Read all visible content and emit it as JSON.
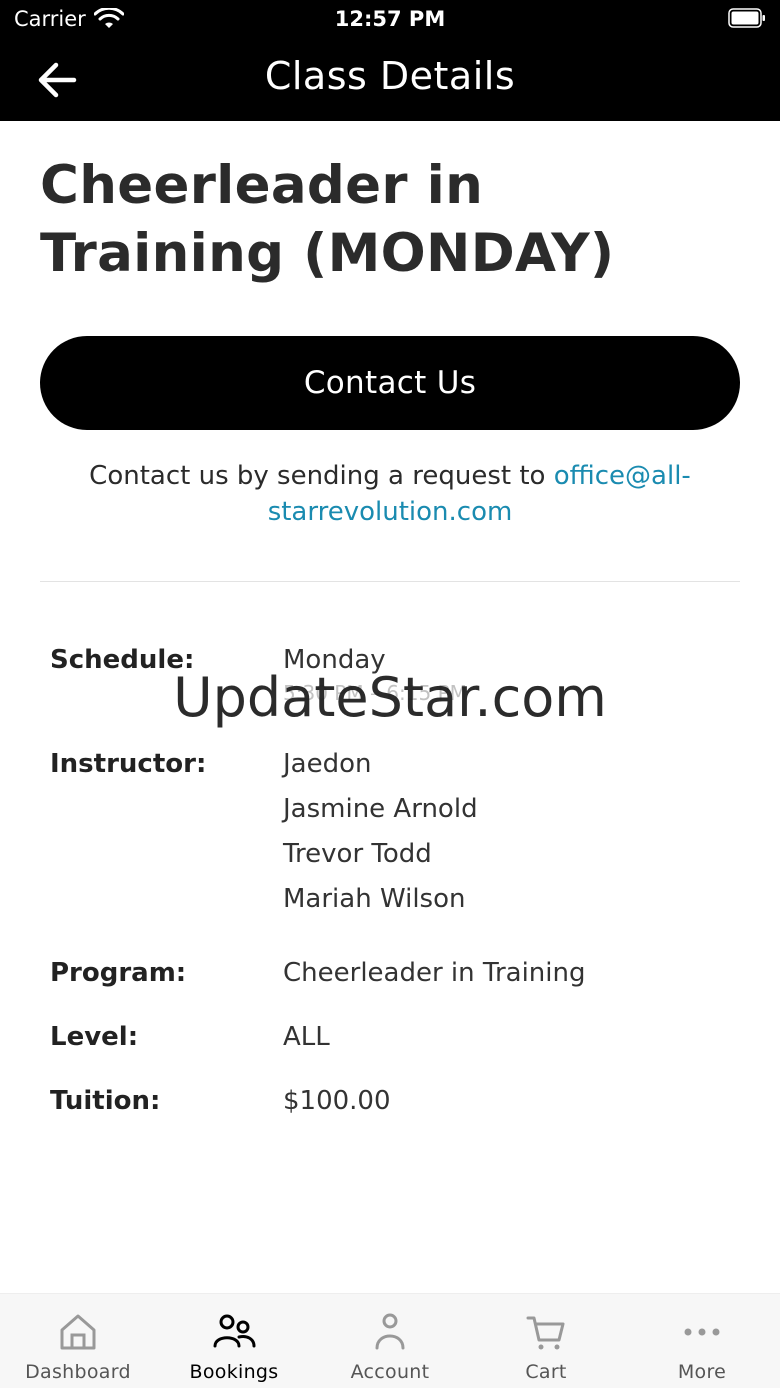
{
  "status_bar": {
    "carrier": "Carrier",
    "time": "12:57 PM"
  },
  "nav": {
    "title": "Class Details"
  },
  "class": {
    "title": "Cheerleader in Training (MONDAY)"
  },
  "contact": {
    "button_label": "Contact Us",
    "note_prefix": "Contact us by sending a request to ",
    "email": "office@all-starrevolution.com"
  },
  "details": {
    "schedule_label": "Schedule:",
    "schedule_day": "Monday",
    "schedule_time": "5:30 PM – 6:15 PM",
    "instructor_label": "Instructor:",
    "instructors": [
      "Jaedon",
      "Jasmine Arnold",
      "Trevor Todd",
      "Mariah Wilson"
    ],
    "program_label": "Program:",
    "program_value": "Cheerleader in Training",
    "level_label": "Level:",
    "level_value": "ALL",
    "tuition_label": "Tuition:",
    "tuition_value": "$100.00"
  },
  "watermark": "UpdateStar.com",
  "tabs": [
    {
      "label": "Dashboard",
      "icon": "home-icon",
      "active": false
    },
    {
      "label": "Bookings",
      "icon": "people-icon",
      "active": true
    },
    {
      "label": "Account",
      "icon": "person-icon",
      "active": false
    },
    {
      "label": "Cart",
      "icon": "cart-icon",
      "active": false
    },
    {
      "label": "More",
      "icon": "more-icon",
      "active": false
    }
  ],
  "colors": {
    "link": "#1a8bb0",
    "header_bg": "#000000",
    "tab_bar_bg": "#f7f7f7"
  }
}
